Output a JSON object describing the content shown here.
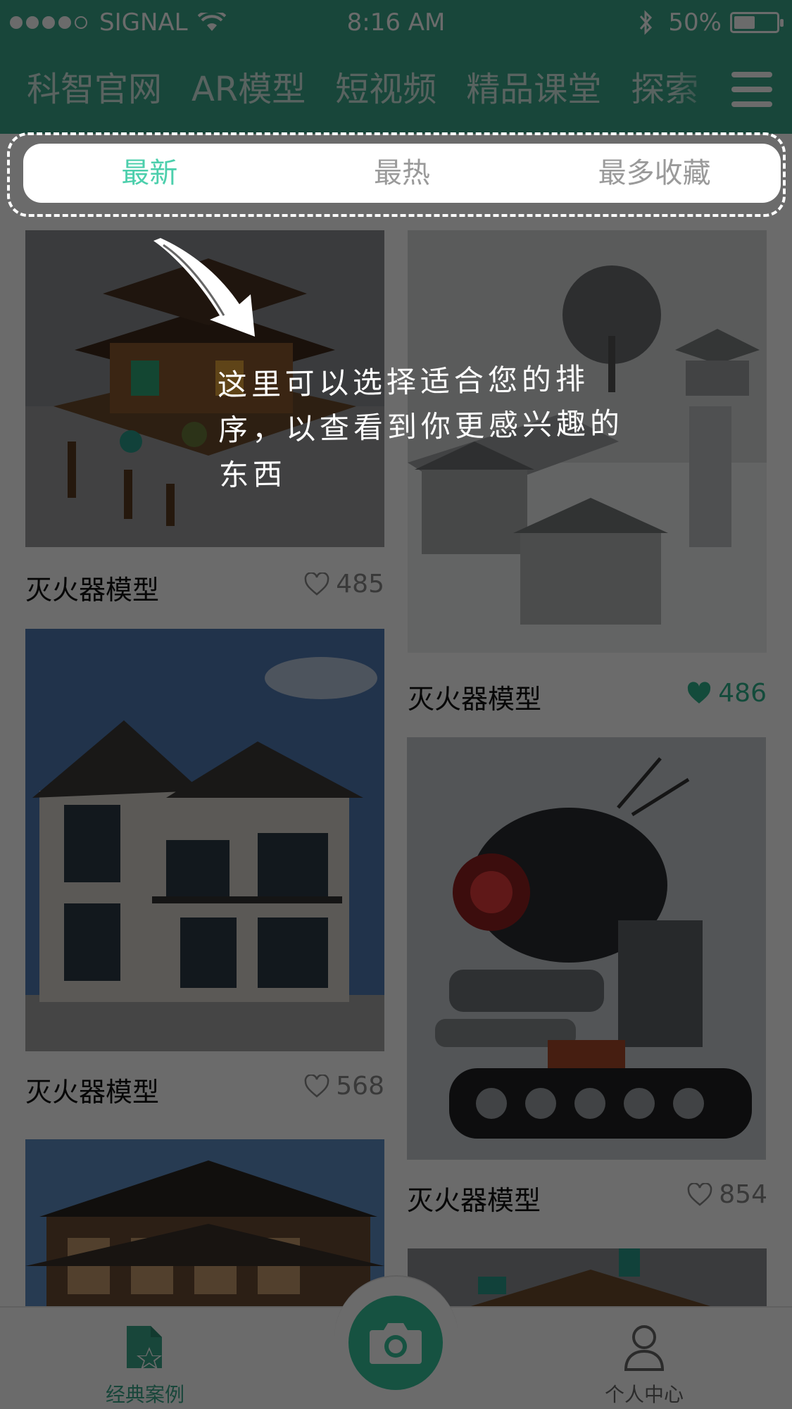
{
  "status_bar": {
    "carrier": "SIGNAL",
    "time": "8:16 AM",
    "battery": "50%",
    "battery_level": 0.5,
    "icons": [
      "signal-dots-icon",
      "wifi-icon",
      "bluetooth-icon",
      "battery-icon"
    ]
  },
  "channel_nav": {
    "tabs": [
      "科智官网",
      "AR模型",
      "短视频",
      "精品课堂",
      "探索"
    ],
    "menu_icon": "menu-icon"
  },
  "sort_bar": {
    "options": [
      "最新",
      "最热",
      "最多收藏"
    ],
    "active_index": 0
  },
  "tip": {
    "text": "这里可以选择适合您的排序，以查看到你更感兴趣的东西",
    "arrow_icon": "hand-drawn-arrow-icon"
  },
  "feed": {
    "items": [
      {
        "title": "灭火器模型",
        "likes": "485",
        "liked": false,
        "image": "pagoda-pavilion"
      },
      {
        "title": "灭火器模型",
        "likes": "486",
        "liked": true,
        "image": "snowy-temple"
      },
      {
        "title": "灭火器模型",
        "likes": "568",
        "liked": false,
        "image": "villa-house"
      },
      {
        "title": "灭火器模型",
        "likes": "854",
        "liked": false,
        "image": "robot-tank"
      },
      {
        "title": "",
        "likes": "",
        "liked": false,
        "image": "chinese-building"
      },
      {
        "title": "",
        "likes": "",
        "liked": false,
        "image": "pagoda-partial"
      }
    ]
  },
  "tabbar": {
    "classic_label": "经典案例",
    "profile_label": "个人中心",
    "camera_icon": "camera-icon"
  },
  "colors": {
    "brand": "#3aa88a",
    "active_sort": "#4ccfac",
    "liked": "#2fb38d",
    "camera": "#36c39c"
  }
}
